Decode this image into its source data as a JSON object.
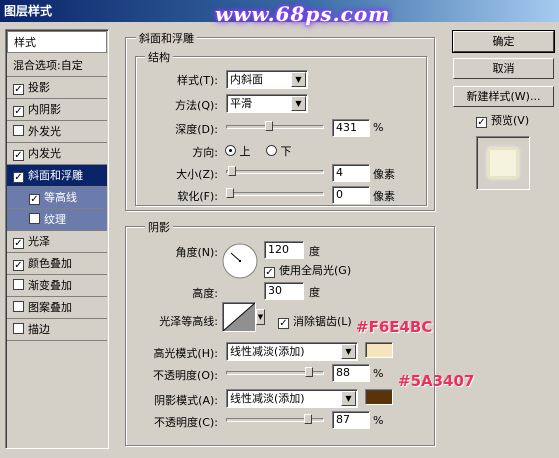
{
  "window": {
    "title": "图层样式",
    "watermark": "www.68ps.com"
  },
  "styles_panel": {
    "header": "样式",
    "blend_options": "混合选项:自定",
    "items": [
      {
        "label": "投影",
        "checked": true
      },
      {
        "label": "内阴影",
        "checked": true
      },
      {
        "label": "外发光",
        "checked": false
      },
      {
        "label": "内发光",
        "checked": true
      },
      {
        "label": "斜面和浮雕",
        "checked": true
      },
      {
        "label": "等高线",
        "checked": true
      },
      {
        "label": "纹理",
        "checked": false
      },
      {
        "label": "光泽",
        "checked": true
      },
      {
        "label": "颜色叠加",
        "checked": true
      },
      {
        "label": "渐变叠加",
        "checked": false
      },
      {
        "label": "图案叠加",
        "checked": false
      },
      {
        "label": "描边",
        "checked": false
      }
    ],
    "check_mark": "✓"
  },
  "bevel": {
    "section_title": "斜面和浮雕",
    "structure_title": "结构",
    "style_label": "样式(T):",
    "style_value": "内斜面",
    "technique_label": "方法(Q):",
    "technique_value": "平滑",
    "depth_label": "深度(D):",
    "depth_value": "431",
    "depth_unit": "%",
    "depth_fraction": 0.43,
    "direction_label": "方向:",
    "direction_up": "上",
    "direction_down": "下",
    "size_label": "大小(Z):",
    "size_value": "4",
    "size_unit": "像素",
    "size_fraction": 0.02,
    "soften_label": "软化(F):",
    "soften_value": "0",
    "soften_unit": "像素",
    "soften_fraction": 0.0
  },
  "shading": {
    "title": "阴影",
    "angle_label": "角度(N):",
    "angle_value": "120",
    "angle_unit": "度",
    "global_light_label": "使用全局光(G)",
    "altitude_label": "高度:",
    "altitude_value": "30",
    "altitude_unit": "度",
    "gloss_contour_label": "光泽等高线:",
    "anti_aliased_label": "消除锯齿(L)",
    "highlight_mode_label": "高光模式(H):",
    "highlight_mode_value": "线性减淡(添加)",
    "highlight_color": "#F6E4BC",
    "highlight_opacity_label": "不透明度(O):",
    "highlight_opacity_value": "88",
    "highlight_opacity_unit": "%",
    "highlight_opacity_fraction": 0.88,
    "shadow_mode_label": "阴影模式(A):",
    "shadow_mode_value": "线性减淡(添加)",
    "shadow_color": "#5A3407",
    "shadow_opacity_label": "不透明度(C):",
    "shadow_opacity_value": "87",
    "shadow_opacity_unit": "%",
    "shadow_opacity_fraction": 0.87
  },
  "annotations": {
    "highlight": "#F6E4BC",
    "shadow": "#5A3407"
  },
  "buttons": {
    "ok": "确定",
    "cancel": "取消",
    "new_style": "新建样式(W)...",
    "preview": "预览(V)"
  }
}
